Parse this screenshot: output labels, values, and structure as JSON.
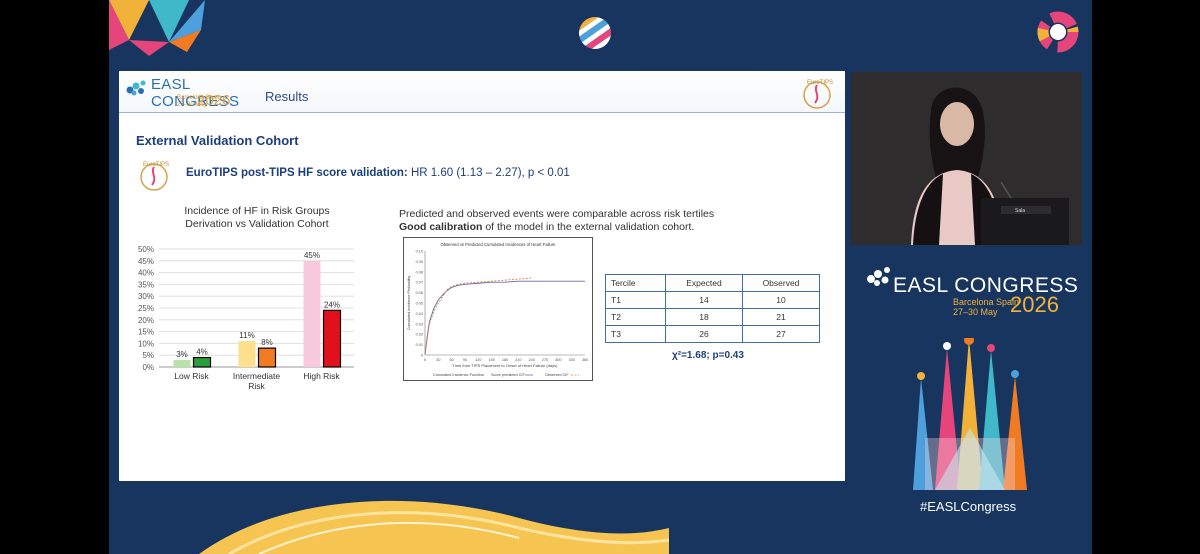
{
  "colors": {
    "background_navy": "#17355e",
    "accent_gold": "#f2b23a",
    "title_blue": "#1c3f7b",
    "bar_low_derivation": "#b9e3a6",
    "bar_low_validation": "#2a9e3a",
    "bar_intermediate_derivation": "#fde08c",
    "bar_intermediate_validation": "#f07b22",
    "bar_high_derivation": "#f9c9dd",
    "bar_high_validation": "#e0111c"
  },
  "slide": {
    "header": {
      "logo_brand": "EASL CONGRESS",
      "logo_place": "Barcelona Spain",
      "logo_dates": "27–30 May",
      "logo_year": "2026",
      "title": "Results"
    },
    "section_title": "External Validation Cohort",
    "hr": {
      "label": "EuroTIPS post-TIPS HF score validation:",
      "value": "HR 1.60 (1.13 – 2.27), p < 0.01"
    },
    "left_chart_title_line1": "Incidence of HF in Risk Groups",
    "left_chart_title_line2": "Derivation vs Validation Cohort",
    "right_text_line1": "Predicted and observed events were comparable across risk tertiles",
    "right_text_bold": "Good calibration",
    "right_text_rest": " of the model in the external validation cohort.",
    "table": {
      "headers": [
        "Tercile",
        "Expected",
        "Observed"
      ],
      "rows": [
        [
          "T1",
          "14",
          "10"
        ],
        [
          "T2",
          "18",
          "21"
        ],
        [
          "T3",
          "26",
          "27"
        ]
      ]
    },
    "chi_square": "χ²=1.68; p=0.43"
  },
  "side": {
    "congress_brand": "EASL CONGRESS",
    "congress_place": "Barcelona Spain",
    "congress_dates": "27–30 May",
    "congress_year": "2026",
    "hashtag": "#EASLCongress",
    "podium_label": "Sala"
  },
  "chart_data": [
    {
      "type": "bar",
      "categories": [
        "Low Risk",
        "Intermediate Risk",
        "High Risk"
      ],
      "series": [
        {
          "values": [
            3,
            11,
            45
          ]
        },
        {
          "values": [
            4,
            8,
            24
          ]
        }
      ],
      "data_labels": [
        [
          "3%",
          "11%",
          "45%"
        ],
        [
          "4%",
          "8%",
          "24%"
        ]
      ],
      "ytick_labels": [
        "0%",
        "5%",
        "10%",
        "15%",
        "20%",
        "25%",
        "30%",
        "35%",
        "40%",
        "45%",
        "50%"
      ],
      "ylim": [
        0,
        50
      ],
      "grid": true
    },
    {
      "type": "line",
      "title": "Observed vs Predicted Cumulated Incidences of Heart Failure",
      "xlabel": "Time from TIPS Placement to Onset of Heart Failure (days)",
      "ylabel": "Cumulated Incidence Probability",
      "xlim": [
        0,
        360
      ],
      "ylim": [
        0,
        0.1
      ],
      "xticks": [
        0,
        30,
        60,
        90,
        120,
        150,
        180,
        210,
        240,
        270,
        300,
        330,
        360
      ],
      "yticks": [
        "0",
        "0.01",
        "0.02",
        "0.03",
        "0.04",
        "0.05",
        "0.06",
        "0.07",
        "0.08",
        "0.09",
        "0.10"
      ],
      "legend": [
        "Cumulated Incidence Function",
        "Score predicted CIF",
        "Observed CIF"
      ],
      "series": [
        {
          "name": "Score predicted CIF",
          "x": [
            0,
            5,
            10,
            20,
            30,
            40,
            50,
            60,
            75,
            90,
            120,
            150,
            180,
            210,
            240,
            270,
            300,
            330,
            360
          ],
          "y": [
            0,
            0.018,
            0.032,
            0.045,
            0.053,
            0.058,
            0.062,
            0.065,
            0.067,
            0.068,
            0.069,
            0.07,
            0.07,
            0.071,
            0.071,
            0.071,
            0.071,
            0.071,
            0.071
          ]
        },
        {
          "name": "Observed CIF",
          "x": [
            0,
            5,
            10,
            20,
            30,
            40,
            50,
            60,
            75,
            90,
            120,
            150,
            180,
            210,
            240
          ],
          "y": [
            0,
            0.015,
            0.03,
            0.042,
            0.05,
            0.056,
            0.063,
            0.066,
            0.068,
            0.069,
            0.07,
            0.071,
            0.072,
            0.073,
            0.074
          ]
        }
      ]
    }
  ]
}
